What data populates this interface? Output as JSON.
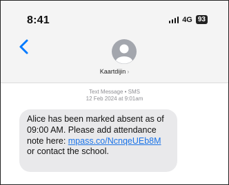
{
  "status_bar": {
    "time": "8:41",
    "network": "4G",
    "battery": "93"
  },
  "header": {
    "contact_name": "Kaartdijin",
    "chevron": "›",
    "icons": {
      "back": "chevron-left-icon",
      "avatar": "person-avatar-icon"
    }
  },
  "thread": {
    "type_label": "Text Message • SMS",
    "timestamp": "12 Feb 2024 at 9:01am"
  },
  "message": {
    "text_before_link": "Alice has been marked absent as of 09:00 AM. Please add attendance note here: ",
    "link_text": "mpass.co/NcnqeUEb8M",
    "text_after_link": " or contact the school."
  },
  "colors": {
    "accent": "#007aff",
    "bubble": "#e9e9eb",
    "link": "#1a73e8"
  }
}
